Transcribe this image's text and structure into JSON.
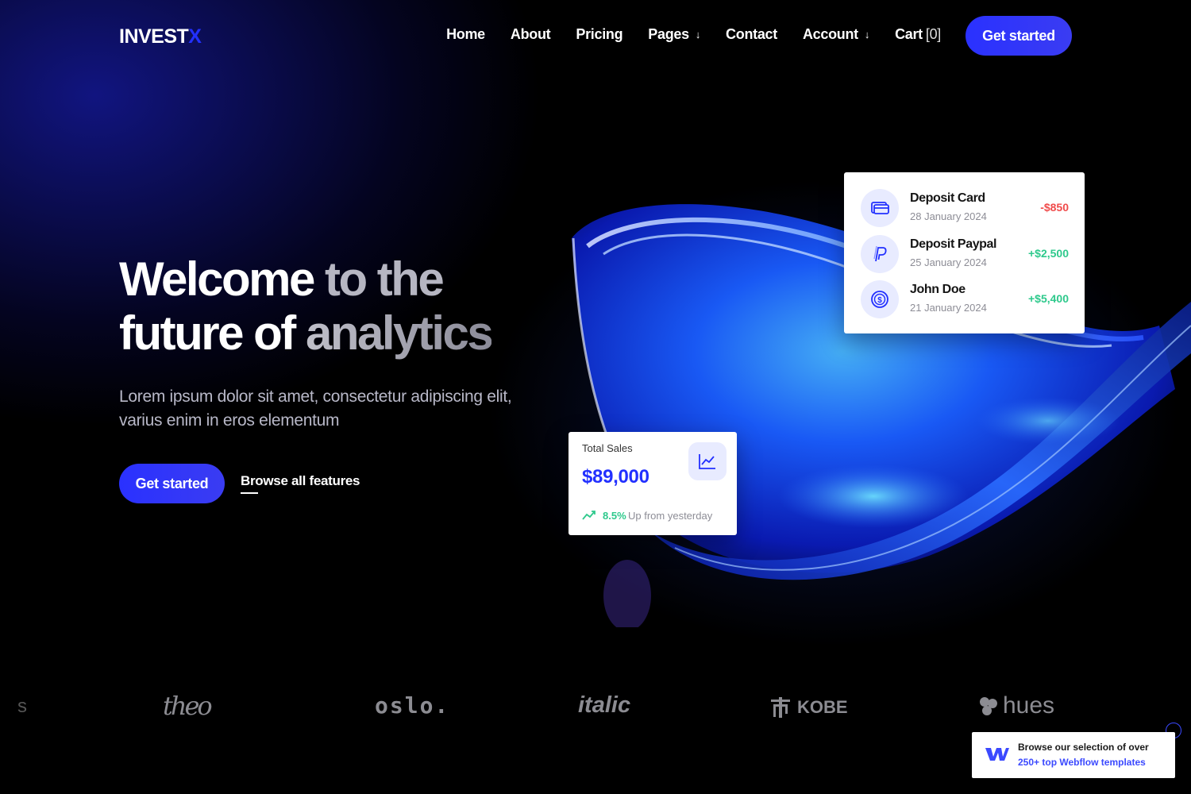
{
  "nav": {
    "logo_main": "INVEST",
    "logo_accent": "X",
    "items": [
      {
        "label": "Home"
      },
      {
        "label": "About"
      },
      {
        "label": "Pricing"
      },
      {
        "label": "Pages"
      },
      {
        "label": "Contact"
      },
      {
        "label": "Account"
      },
      {
        "label": "Cart"
      }
    ],
    "cart_count": "[0]",
    "cta": "Get started"
  },
  "hero": {
    "title_1a": "Welcome",
    "title_1b": " to the",
    "title_2a": "future of",
    "title_2b": " analytics",
    "subtitle": "Lorem ipsum dolor sit amet, consectetur adipiscing elit, varius enim in eros elementum",
    "cta": "Get started",
    "browse": "Browse all features"
  },
  "transactions": [
    {
      "name": "Deposit Card",
      "date": "28 January 2024",
      "amount": "-$850",
      "icon": "card-icon"
    },
    {
      "name": "Deposit Paypal",
      "date": "25 January 2024",
      "amount": "+$2,500",
      "icon": "paypal-icon"
    },
    {
      "name": "John Doe",
      "date": "21 January 2024",
      "amount": "+$5,400",
      "icon": "coin-icon"
    }
  ],
  "sales": {
    "label": "Total Sales",
    "value": "$89,000",
    "trend_pct": "8.5%",
    "trend_text": "Up from yesterday"
  },
  "logos": {
    "edge": "s",
    "theo": "theo",
    "oslo": "oslo.",
    "italic": "italic",
    "kobe": "KOBE",
    "hues": "hues"
  },
  "promo": {
    "line1": "Browse our selection of over",
    "line2": "250+ top Webflow templates"
  },
  "colors": {
    "accent": "#2a31ff",
    "positive": "#2ec98c",
    "negative": "#f04b4b"
  }
}
